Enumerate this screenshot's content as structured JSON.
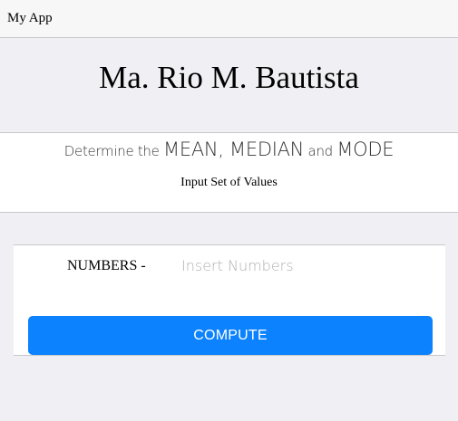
{
  "header": {
    "app_title": "My App"
  },
  "page": {
    "name": "Ma. Rio M. Bautista"
  },
  "info": {
    "subtitle_parts": {
      "p1": "Determine the ",
      "p2": "MEAN, MEDIAN",
      "p3": " and ",
      "p4": "MODE"
    },
    "instructions": "Input Set of Values"
  },
  "form": {
    "numbers_label": "NUMBERS -",
    "numbers_placeholder": "Insert Numbers",
    "numbers_value": "",
    "compute_label": "COMPUTE"
  },
  "colors": {
    "background": "#efeff4",
    "header_bg": "#f7f7f8",
    "card_bg": "#ffffff",
    "accent": "#0d82ff",
    "button_text": "#ffffff",
    "placeholder": "#b0b0b0"
  }
}
